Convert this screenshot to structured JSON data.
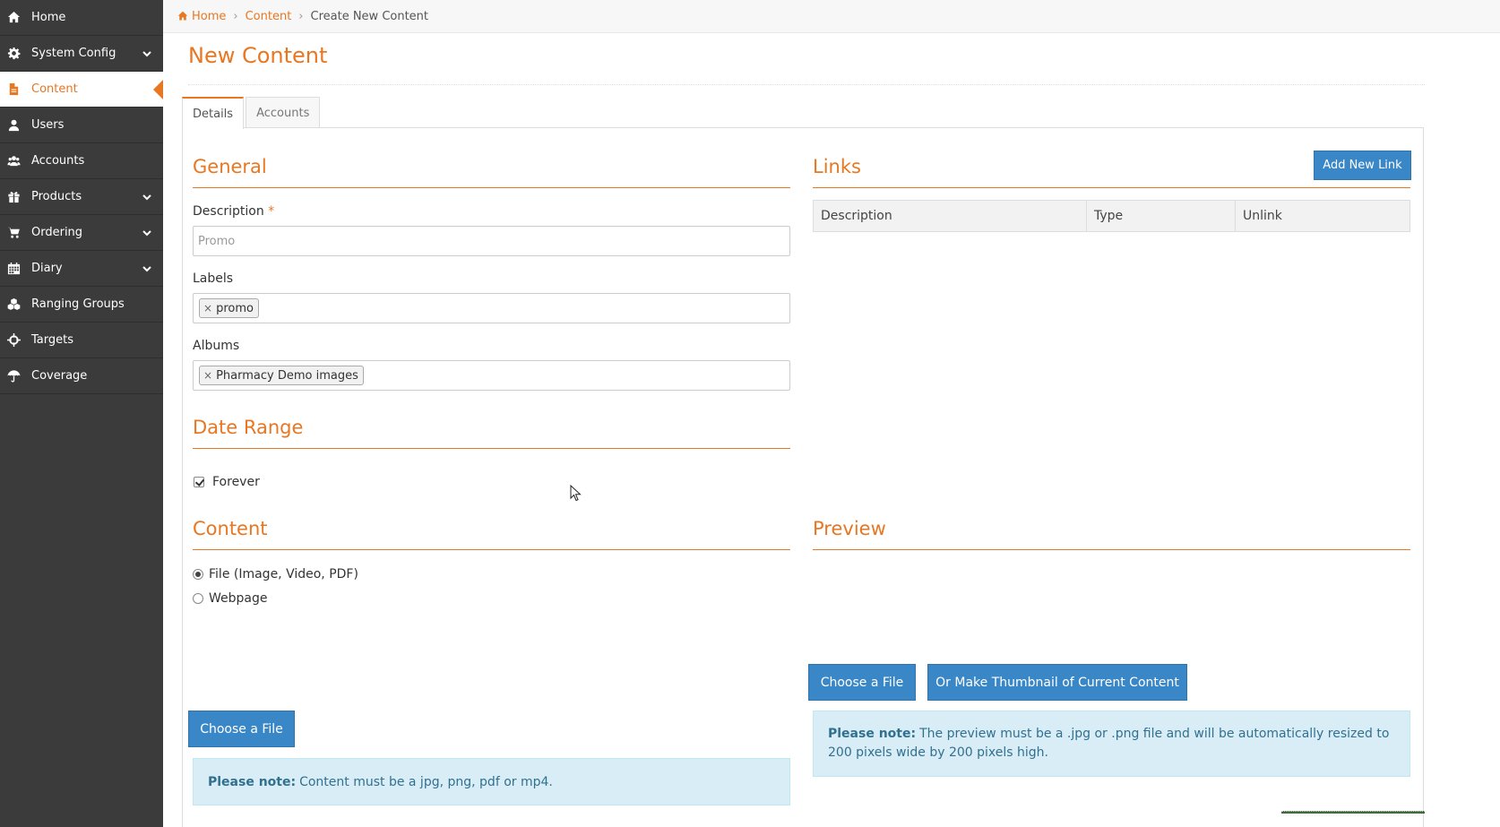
{
  "sidebar": {
    "items": [
      {
        "label": "Home",
        "icon": "home-icon",
        "expandable": false,
        "active": false
      },
      {
        "label": "System Config",
        "icon": "gear-icon",
        "expandable": true,
        "active": false
      },
      {
        "label": "Content",
        "icon": "file-icon",
        "expandable": false,
        "active": true
      },
      {
        "label": "Users",
        "icon": "user-icon",
        "expandable": false,
        "active": false
      },
      {
        "label": "Accounts",
        "icon": "users-icon",
        "expandable": false,
        "active": false
      },
      {
        "label": "Products",
        "icon": "gift-icon",
        "expandable": true,
        "active": false
      },
      {
        "label": "Ordering",
        "icon": "cart-icon",
        "expandable": true,
        "active": false
      },
      {
        "label": "Diary",
        "icon": "calendar-icon",
        "expandable": true,
        "active": false
      },
      {
        "label": "Ranging Groups",
        "icon": "cubes-icon",
        "expandable": false,
        "active": false
      },
      {
        "label": "Targets",
        "icon": "crosshairs-icon",
        "expandable": false,
        "active": false
      },
      {
        "label": "Coverage",
        "icon": "umbrella-icon",
        "expandable": false,
        "active": false
      }
    ]
  },
  "breadcrumb": {
    "home": "Home",
    "section": "Content",
    "current": "Create New Content"
  },
  "page": {
    "title": "New Content"
  },
  "tabs": [
    {
      "label": "Details",
      "active": true
    },
    {
      "label": "Accounts",
      "active": false
    }
  ],
  "general": {
    "heading": "General",
    "description_label": "Description",
    "description_required": "*",
    "description_placeholder": "Promo",
    "labels_label": "Labels",
    "labels_tags": [
      "promo"
    ],
    "albums_label": "Albums",
    "albums_tags": [
      "Pharmacy Demo images"
    ]
  },
  "date_range": {
    "heading": "Date Range",
    "forever_label": "Forever",
    "forever_checked": true
  },
  "content": {
    "heading": "Content",
    "options": [
      {
        "label": "File (Image, Video, PDF)",
        "checked": true
      },
      {
        "label": "Webpage",
        "checked": false
      }
    ],
    "choose_file_label": "Choose a File",
    "note_strong": "Please note:",
    "note_text": "Content must be a jpg, png, pdf or mp4."
  },
  "links": {
    "heading": "Links",
    "add_button": "Add New Link",
    "columns": [
      "Description",
      "Type",
      "Unlink"
    ]
  },
  "preview": {
    "heading": "Preview",
    "choose_file_label": "Choose a File",
    "thumbnail_label": "Or Make Thumbnail of Current Content",
    "note_strong": "Please note:",
    "note_text": "The preview must be a .jpg or .png file and will be automatically resized to 200 pixels wide by 200 pixels high."
  },
  "colors": {
    "accent": "#e87722",
    "sidebar_bg": "#3b3b3b",
    "button_blue": "#3a87c8",
    "note_bg": "#d9edf7",
    "note_text": "#31708f"
  }
}
